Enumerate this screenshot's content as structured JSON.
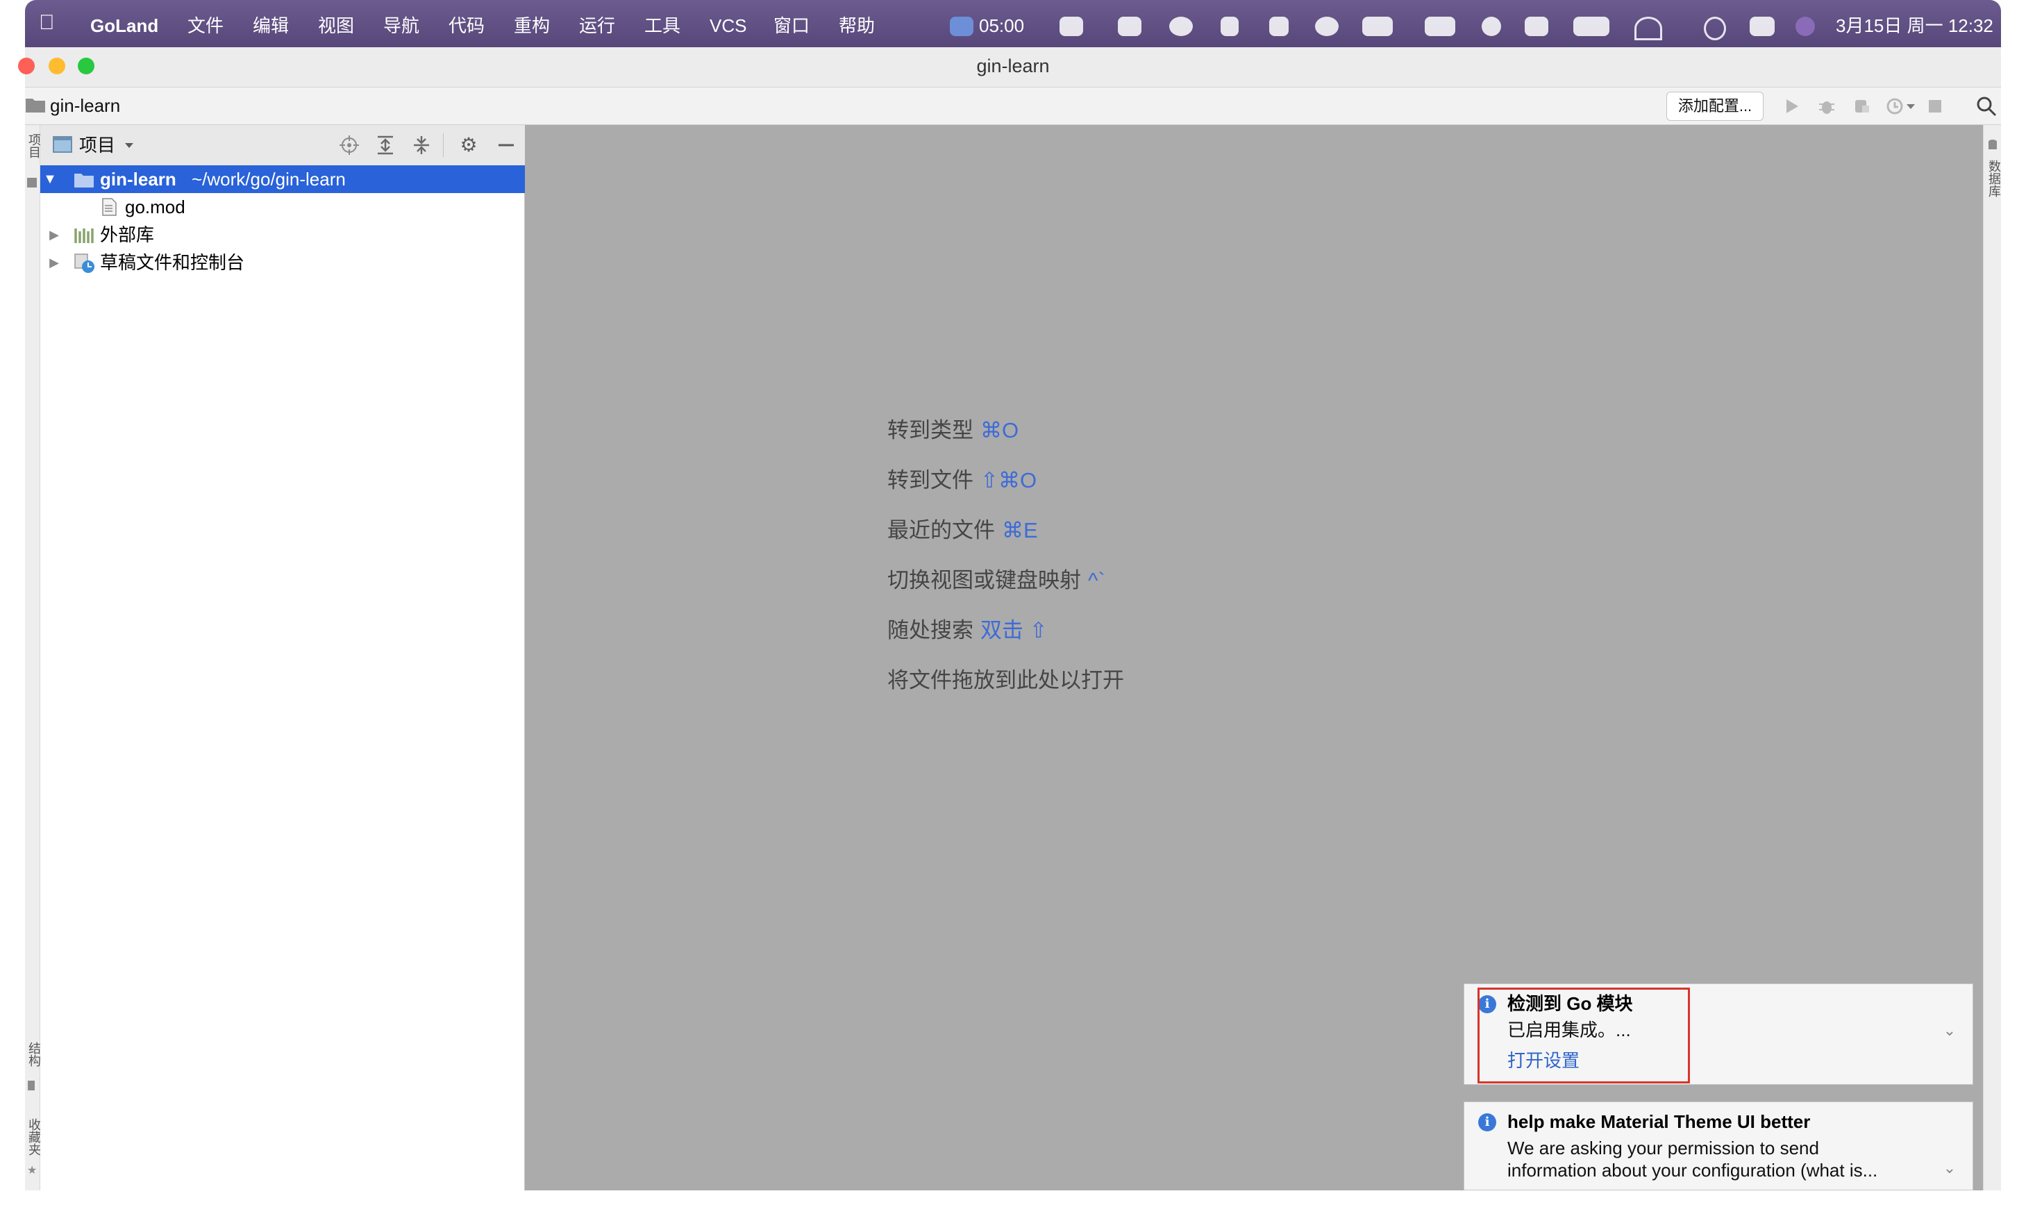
{
  "menubar": {
    "app": "GoLand",
    "menus": [
      "文件",
      "编辑",
      "视图",
      "导航",
      "代码",
      "重构",
      "运行",
      "工具",
      "VCS",
      "窗口",
      "帮助"
    ],
    "clock_badge": "05:00",
    "datetime": "3月15日 周一 12:32"
  },
  "window": {
    "title": "gin-learn"
  },
  "navbar": {
    "breadcrumb": "gin-learn",
    "add_config_label": "添加配置..."
  },
  "stripes": {
    "left_top": "项目",
    "left_structure": "结构",
    "left_favorites": "收藏夹",
    "right_database": "数据库"
  },
  "project_panel": {
    "header_label": "项目",
    "tree": [
      {
        "label": "gin-learn",
        "path": "~/work/go/gin-learn",
        "icon": "folder-icon"
      },
      {
        "label": "go.mod",
        "icon": "file-icon"
      },
      {
        "label": "外部库",
        "icon": "library-icon"
      },
      {
        "label": "草稿文件和控制台",
        "icon": "scratch-icon"
      }
    ]
  },
  "editor": {
    "hints": [
      {
        "text": "转到类型",
        "key": "⌘O"
      },
      {
        "text": "转到文件",
        "key": "⇧⌘O"
      },
      {
        "text": "最近的文件",
        "key": "⌘E"
      },
      {
        "text": "切换视图或键盘映射",
        "key": "^`"
      },
      {
        "text": "随处搜索",
        "key": "双击 ⇧"
      },
      {
        "text": "将文件拖放到此处以打开",
        "key": ""
      }
    ]
  },
  "notifications": [
    {
      "title": "检测到 Go 模块",
      "body": "已启用集成。...",
      "link": "打开设置"
    },
    {
      "title": "help make Material Theme UI better",
      "body_line1": "We are asking your permission to send",
      "body_line2": "information about your configuration (what is..."
    }
  ],
  "colors": {
    "menubar": "#5f4f85",
    "selection": "#2962d9",
    "editor_bg": "#ababab",
    "link": "#2f65ca",
    "highlight_box": "#d9342b"
  }
}
